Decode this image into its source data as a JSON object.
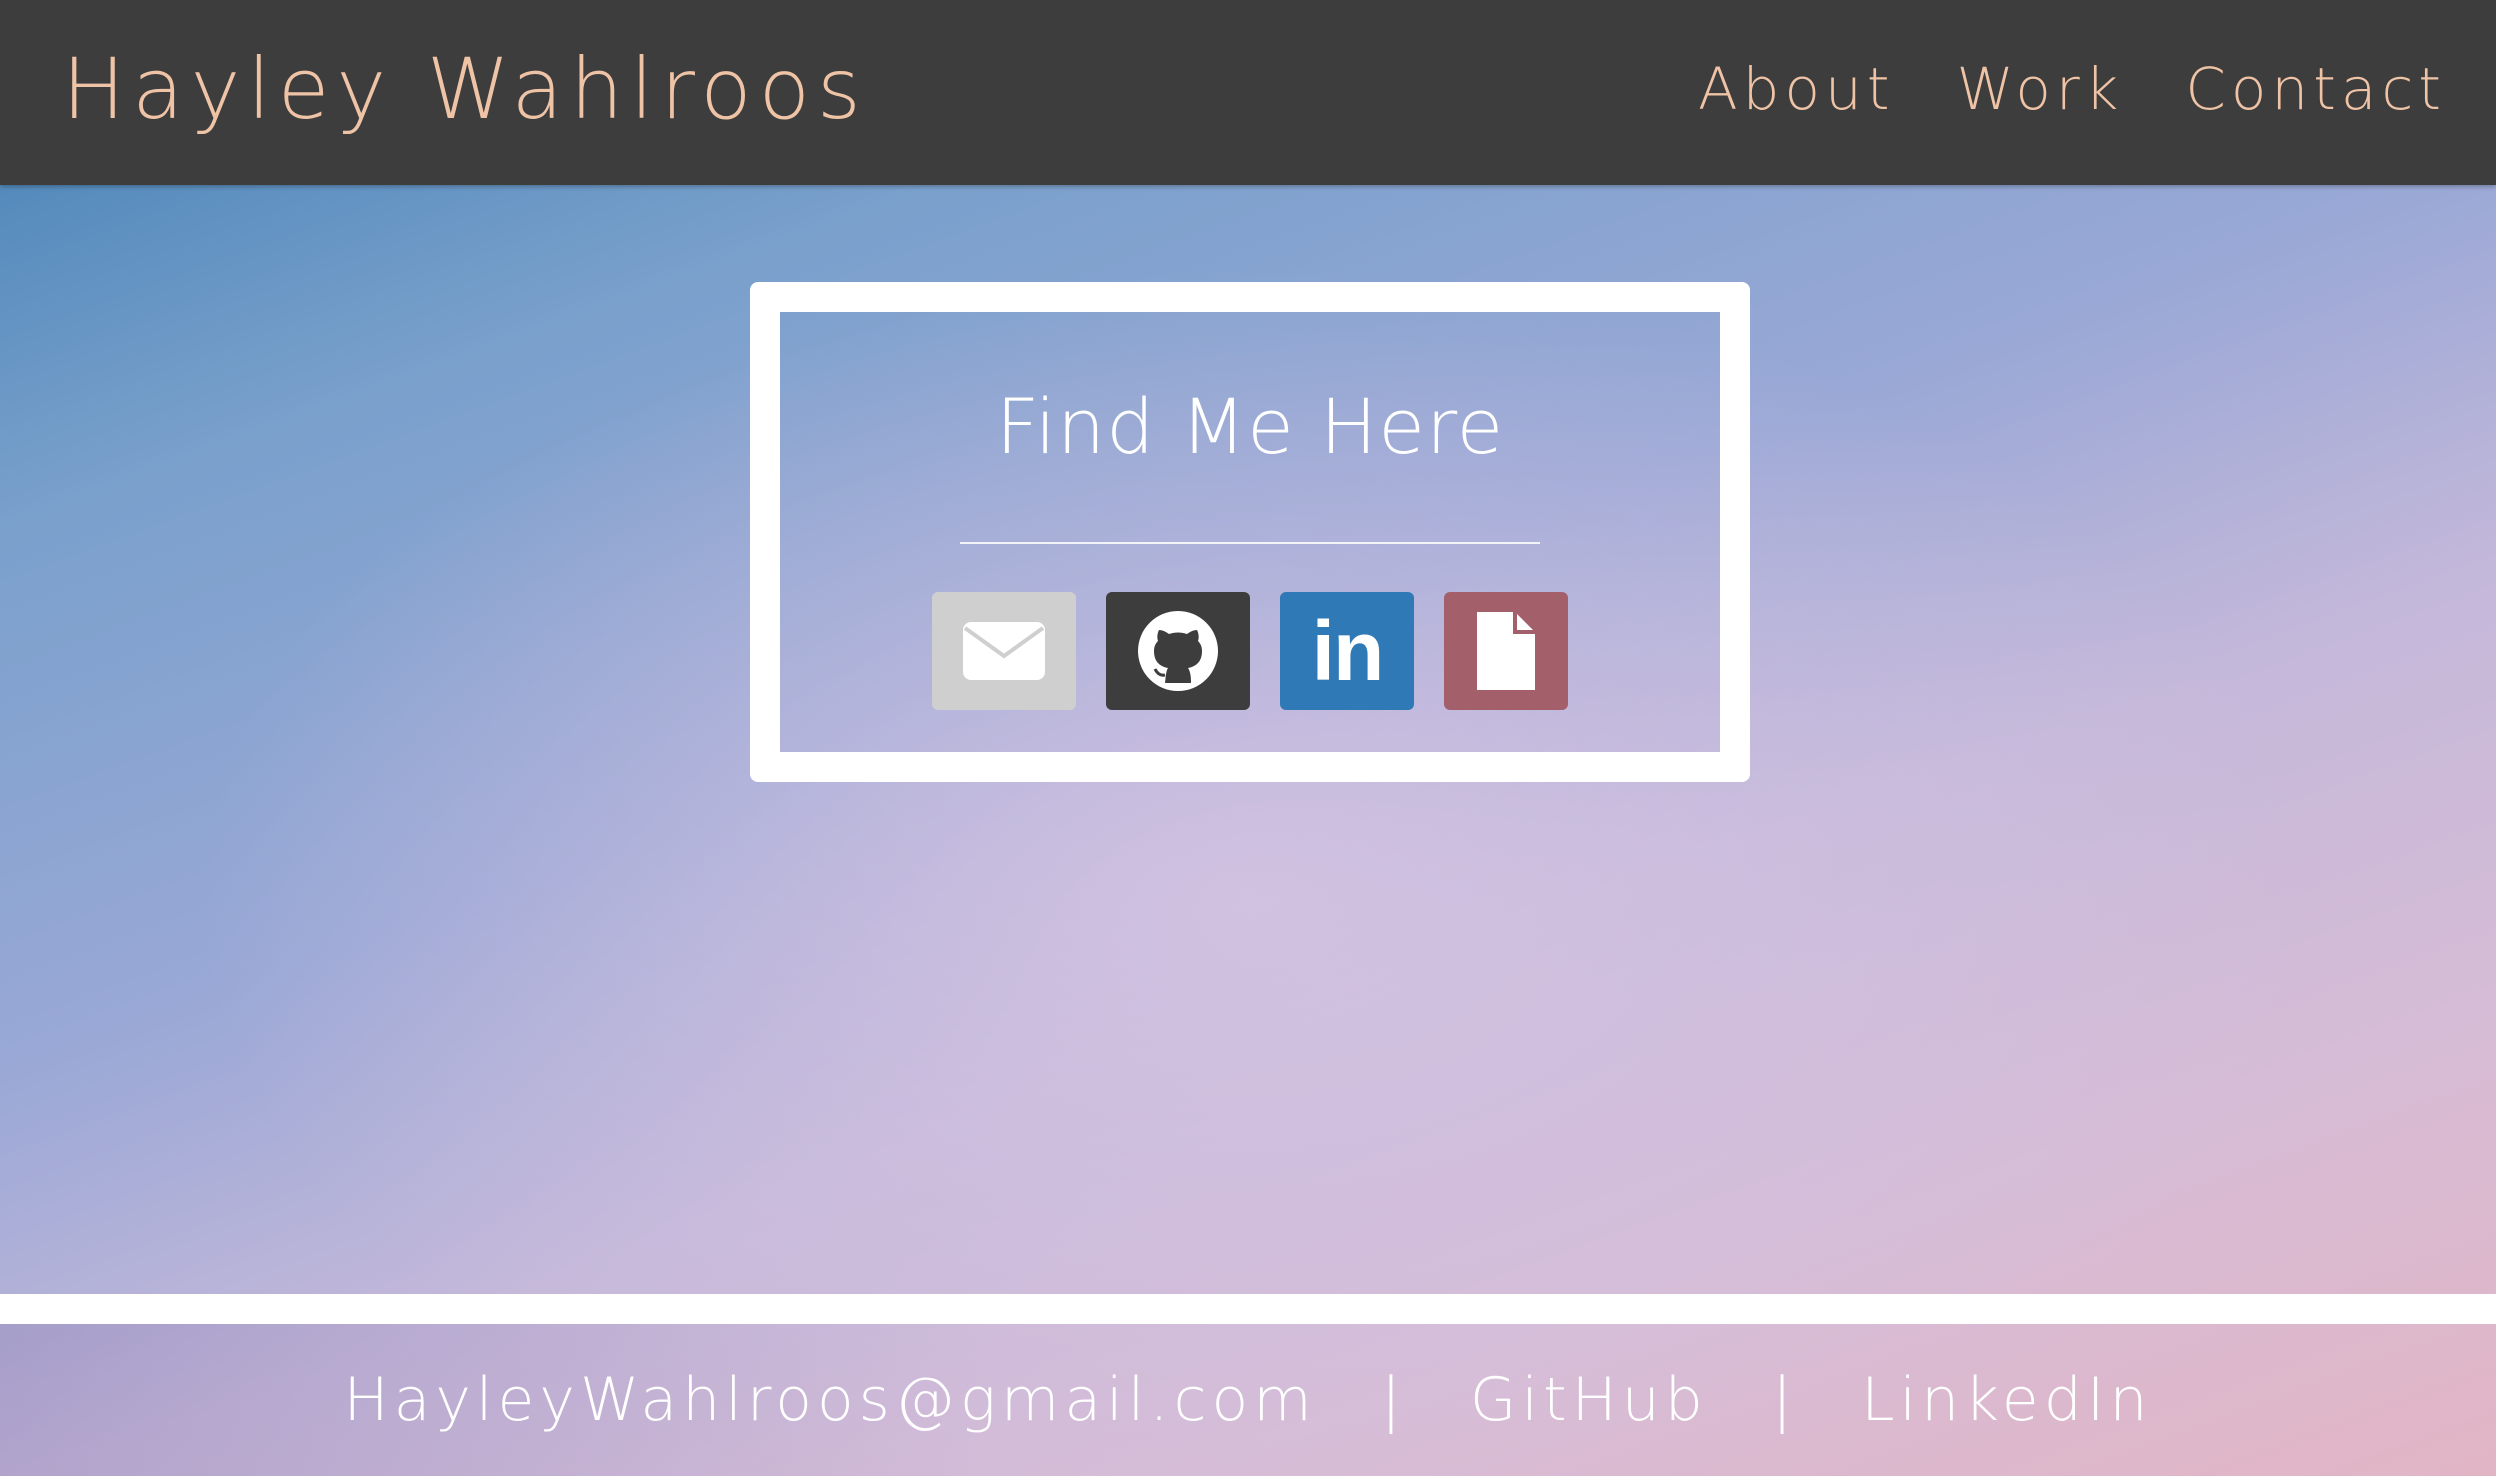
{
  "header": {
    "site_title": "Hayley Wahlroos",
    "nav": [
      {
        "label": "About"
      },
      {
        "label": "Work"
      },
      {
        "label": "Contact"
      }
    ]
  },
  "card": {
    "title": "Find Me Here",
    "icons": [
      {
        "name": "email",
        "icon": "envelope-icon",
        "color": "#cfcfcf"
      },
      {
        "name": "github",
        "icon": "github-icon",
        "color": "#3d3d3d"
      },
      {
        "name": "linkedin",
        "icon": "linkedin-icon",
        "color": "#2f7ab6",
        "glyph": "in"
      },
      {
        "name": "resume",
        "icon": "file-icon",
        "color": "#a35f6a"
      }
    ]
  },
  "footer": {
    "email": "HayleyWahlroos@gmail.com",
    "separator": "|",
    "github": "GitHub",
    "linkedin": "LinkedIn"
  },
  "colors": {
    "header_bg": "#3d3d3d",
    "accent": "#efc3a6",
    "card_border": "#ffffff"
  }
}
